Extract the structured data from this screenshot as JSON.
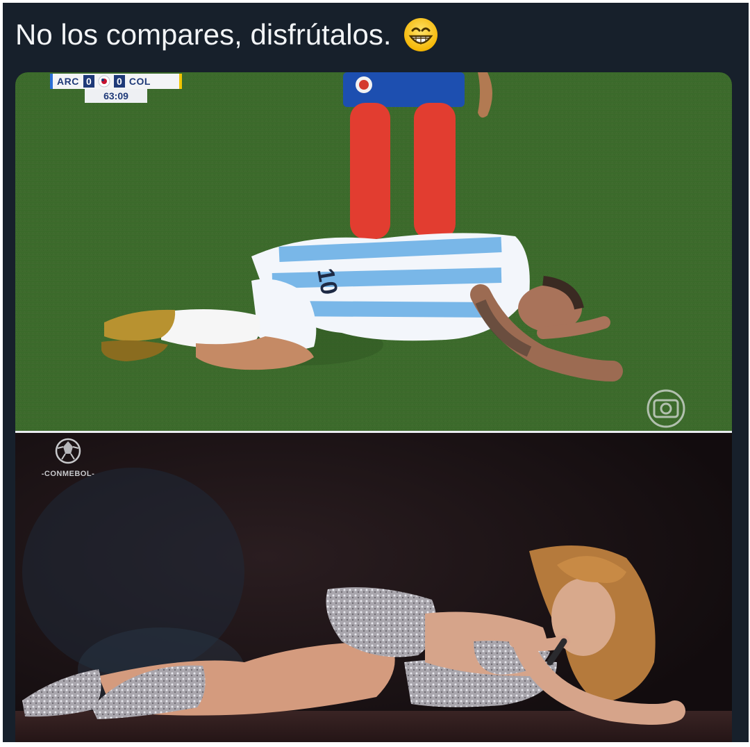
{
  "tweet": {
    "text": "No los compares, disfrútalos.",
    "emoji": "grinning-face-with-smiling-eyes"
  },
  "scoreboard": {
    "home_team": "ARC",
    "home_score": "0",
    "away_score": "0",
    "away_team": "COL",
    "clock": "63:09"
  },
  "watermark": {
    "conmebol": "-CONMEBOL-"
  },
  "colors": {
    "background": "#17202b",
    "text": "#f2f4f6",
    "pitch": "#3e6a2c",
    "stage": "#1c1416"
  }
}
